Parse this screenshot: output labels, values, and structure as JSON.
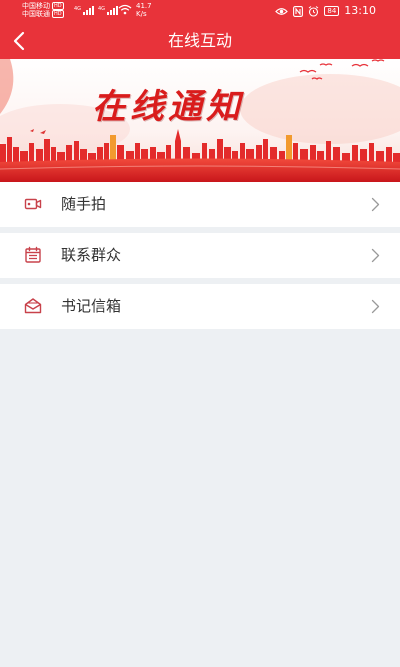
{
  "status_bar": {
    "carrier_1": "中国移动",
    "carrier_2": "中国联通",
    "hd_label": "HD",
    "net_type": "4G",
    "net_speed_value": "41.7",
    "net_speed_unit": "K/s",
    "battery": "84",
    "time": "13:10"
  },
  "nav": {
    "title": "在线互动"
  },
  "banner": {
    "headline": "在线通知"
  },
  "menu": {
    "items": [
      {
        "label": "随手拍",
        "icon": "video-camera-icon"
      },
      {
        "label": "联系群众",
        "icon": "calendar-icon"
      },
      {
        "label": "书记信箱",
        "icon": "open-envelope-icon"
      }
    ]
  },
  "colors": {
    "primary_red": "#e8333a",
    "icon_red": "#c8424b",
    "background": "#edf0f3",
    "text": "#333333"
  }
}
